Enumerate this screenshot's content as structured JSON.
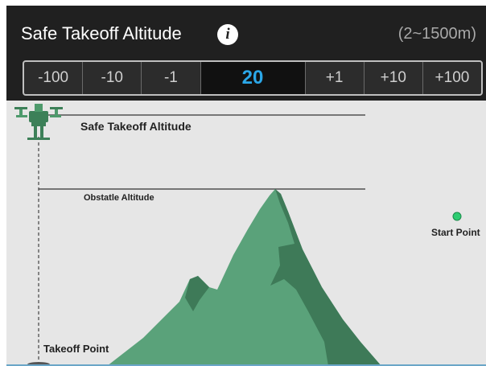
{
  "header": {
    "title": "Safe Takeoff Altitude",
    "info_icon": "info-icon",
    "range": "(2~1500m)"
  },
  "stepper": {
    "buttons": [
      "-100",
      "-10",
      "-1",
      "+1",
      "+10",
      "+100"
    ],
    "value": "20",
    "value_color": "#2ba7e8"
  },
  "diagram": {
    "safe_altitude_label": "Safe Takeoff Altitude",
    "obstacle_label": "Obstatle Altitude",
    "start_point_label": "Start Point",
    "takeoff_point_label": "Takeoff Point",
    "mountain_color": "#5aa27a",
    "mountain_shadow_color": "#3e7a58",
    "start_dot_color": "#2ecc71",
    "drone_icon": "drone-icon"
  }
}
